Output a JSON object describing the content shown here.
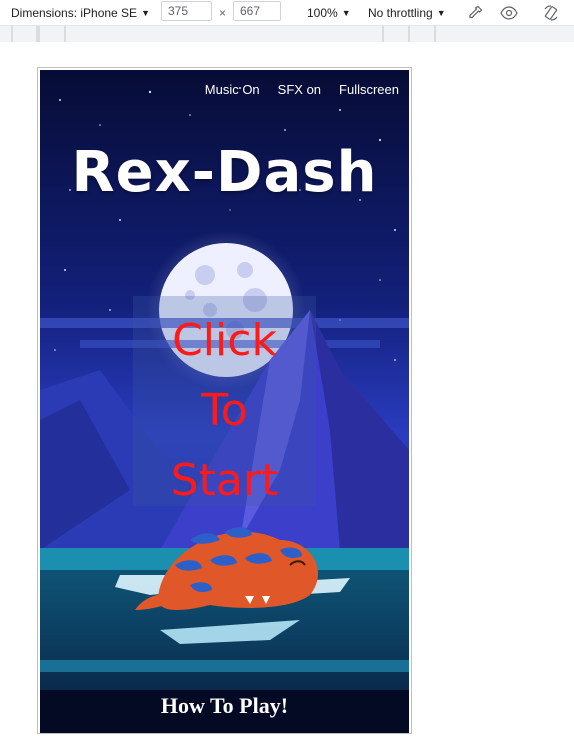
{
  "devtools": {
    "dimensions_label": "Dimensions: iPhone SE",
    "width_value": "375",
    "times_sign": "×",
    "height_value": "667",
    "zoom_label": "100%",
    "throttling_label": "No throttling",
    "icons": [
      "caret-down-icon",
      "eyedropper-icon",
      "eye-icon",
      "rotate-icon"
    ]
  },
  "game": {
    "menu": {
      "music": "Music On",
      "sfx": "SFX on",
      "fullscreen": "Fullscreen"
    },
    "title": "Rex-Dash",
    "start_lines": [
      "Click",
      "To",
      "Start"
    ],
    "how_to_play": "How To Play!",
    "colors": {
      "sky_top": "#0a0f3a",
      "sky_mid": "#1a2a8c",
      "mountain": "#3b3fc9",
      "ice": "#2fb3c9",
      "start_text": "#ff1a1a",
      "dino_body": "#e0582a",
      "dino_stripes": "#2d5fc9"
    }
  }
}
